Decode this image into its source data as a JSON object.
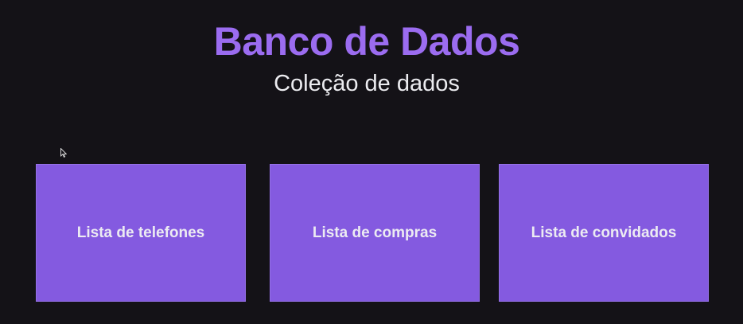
{
  "header": {
    "title": "Banco de Dados",
    "subtitle": "Coleção de dados"
  },
  "cards": [
    {
      "label": "Lista de telefones"
    },
    {
      "label": "Lista de compras"
    },
    {
      "label": "Lista de convidados"
    }
  ],
  "colors": {
    "background": "#141217",
    "accent": "#9b6cf0",
    "card": "#845ae0",
    "text": "#ecebf2"
  },
  "cursor_icon": "mouse-pointer-icon"
}
